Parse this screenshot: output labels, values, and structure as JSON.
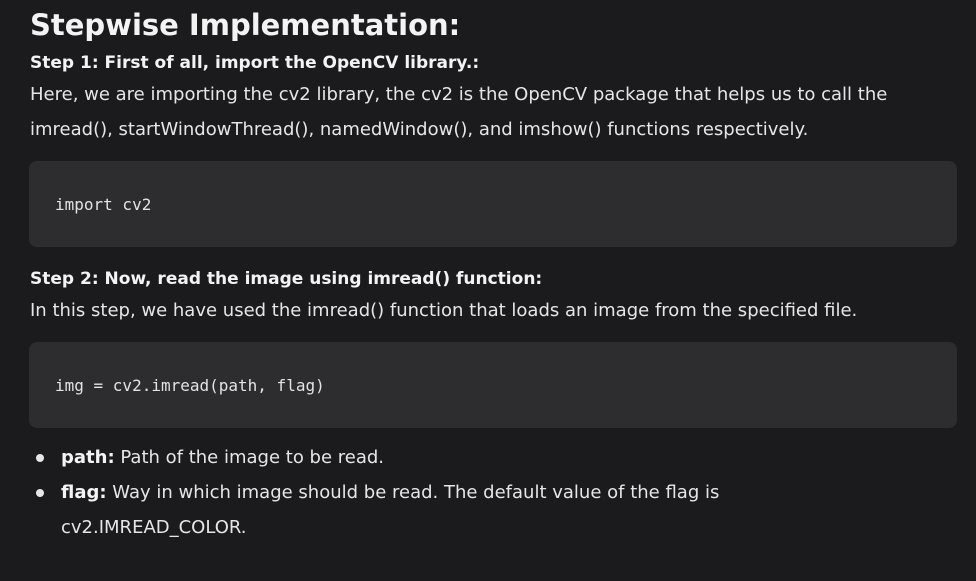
{
  "title": "Stepwise Implementation:",
  "step1": {
    "heading": "Step 1: First of all, import the OpenCV library.:",
    "paragraph_line1": "Here, we are importing the cv2 library, the cv2 is the OpenCV package that helps us to call the",
    "paragraph_line2": "imread(), startWindowThread(), namedWindow(), and imshow() functions respectively.",
    "code": "import cv2"
  },
  "step2": {
    "heading": "Step 2: Now, read the image using imread() function:",
    "paragraph": "In this step, we have used the imread() function that loads an image from the specified file.",
    "code": "img = cv2.imread(path, flag)"
  },
  "bullets": [
    {
      "term": "path:",
      "text_line1": " Path of the image to be read.",
      "text_line2": ""
    },
    {
      "term": "flag:",
      "text_line1": " Way in which image should be read. The default value of the flag is",
      "text_line2": "cv2.IMREAD_COLOR."
    }
  ],
  "colors": {
    "background": "#1b1b1d",
    "code_background": "#2d2d30",
    "text": "#e6e6e7"
  }
}
